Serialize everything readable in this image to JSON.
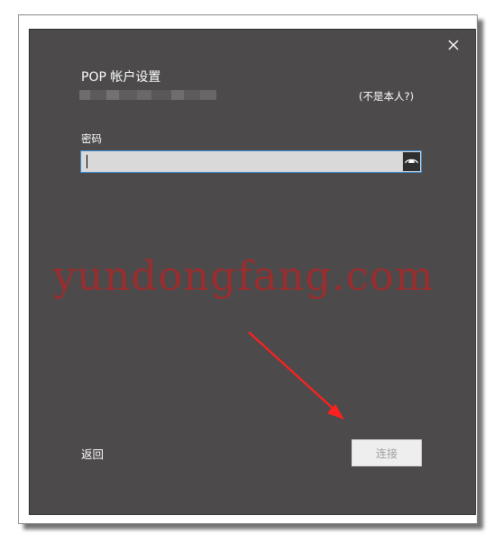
{
  "dialog": {
    "title": "POP 帐户设置",
    "not_you_link": "(不是本人?)",
    "password_label": "密码",
    "password_value": "",
    "back_link": "返回",
    "connect_button": "连接",
    "close_icon": "close-icon",
    "reveal_icon": "eye-reveal-icon"
  },
  "watermark": {
    "text": "yundongfang.com"
  },
  "colors": {
    "dialog_bg": "#4c4a4b",
    "input_bg": "#d9d9d9",
    "input_border": "#3d8fd6",
    "button_disabled_bg": "#eeeeee",
    "button_disabled_text": "#a0a0a0",
    "annotation_arrow": "#ff2020",
    "watermark": "#b92323"
  }
}
